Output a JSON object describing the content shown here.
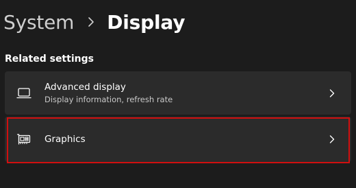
{
  "breadcrumb": {
    "parent": "System",
    "current": "Display"
  },
  "section": {
    "title": "Related settings"
  },
  "items": [
    {
      "title": "Advanced display",
      "subtitle": "Display information, refresh rate",
      "icon": "monitor-icon"
    },
    {
      "title": "Graphics",
      "subtitle": "",
      "icon": "graphics-card-icon",
      "highlighted": true
    }
  ],
  "colors": {
    "background": "#1c1c1c",
    "card": "#2b2b2b",
    "highlight": "#d10f0f"
  }
}
